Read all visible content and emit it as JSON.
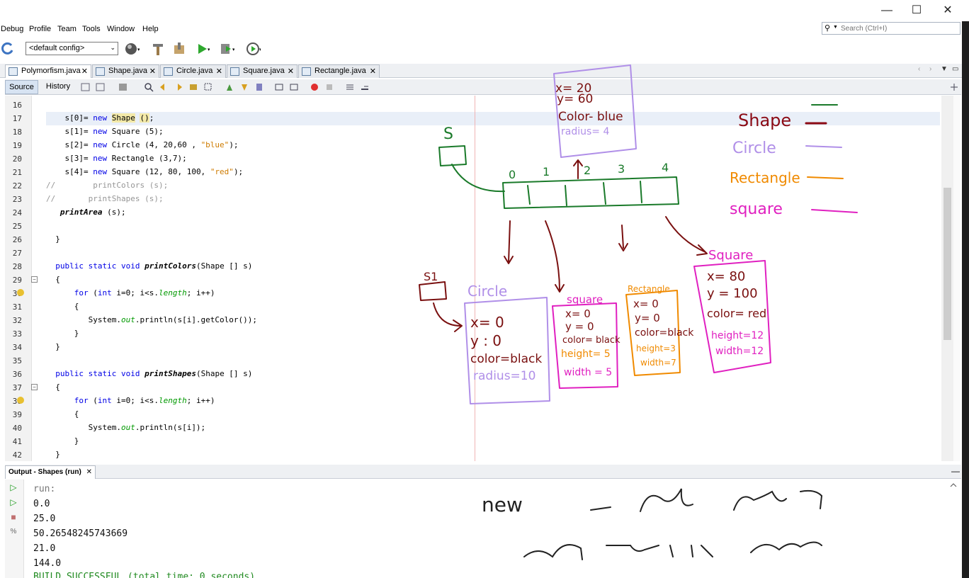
{
  "window": {
    "minimize_glyph": "—",
    "maximize_glyph": "☐",
    "close_glyph": "✕"
  },
  "menu": [
    "Debug",
    "Profile",
    "Team",
    "Tools",
    "Window",
    "Help"
  ],
  "search": {
    "placeholder": "Search (Ctrl+I)"
  },
  "toolbar": {
    "config_value": "<default config>"
  },
  "tabs": [
    {
      "label": "Polymorfism.java",
      "active": true
    },
    {
      "label": "Shape.java",
      "active": false
    },
    {
      "label": "Circle.java",
      "active": false
    },
    {
      "label": "Square.java",
      "active": false
    },
    {
      "label": "Rectangle.java",
      "active": false
    }
  ],
  "editor_toolbar": {
    "source": "Source",
    "history": "History"
  },
  "code": {
    "line_numbers": [
      "16",
      "17",
      "18",
      "19",
      "20",
      "21",
      "22",
      "23",
      "24",
      "25",
      "26",
      "27",
      "28",
      "29",
      "30",
      "31",
      "32",
      "33",
      "34",
      "35",
      "36",
      "37",
      "38",
      "39",
      "40",
      "41",
      "42"
    ]
  },
  "output": {
    "title": "Output - Shapes (run)",
    "lines": [
      "run:",
      "0.0",
      "25.0",
      "50.26548245743669",
      "21.0",
      "144.0",
      "BUILD SUCCESSFUL (total time: 0 seconds)"
    ]
  },
  "annotations": {
    "legend": [
      "Shape",
      "Circle",
      "Rectangle",
      "square"
    ],
    "array_indices": [
      "0",
      "1",
      "2",
      "3",
      "4"
    ],
    "labels": {
      "s": "S",
      "s1": "S1",
      "new": "new"
    },
    "circle_obj": {
      "title": "Circle",
      "x": "x= 0",
      "y": "y : 0",
      "color": "color=black",
      "radius": "radius=10"
    },
    "square_obj": {
      "title": "square",
      "x": "x= 0",
      "y": "y = 0",
      "color": "color= black",
      "height": "height= 5",
      "width": "width = 5"
    },
    "rect_obj": {
      "title": "Rectangle",
      "x": "x= 0",
      "y": "y= 0",
      "color": "color=black",
      "height": "height=3",
      "width": "width=7"
    },
    "square2_obj": {
      "title": "Square",
      "x": "x= 80",
      "y": "y = 100",
      "color": "color= red",
      "height": "height=12",
      "width": "width=12"
    },
    "circle_top": {
      "x": "x= 20",
      "y": "y= 60",
      "color": "Color- blue",
      "radius": "radius= 4"
    },
    "colors": {
      "shape": "#8b0a14",
      "circle": "#b08fe8",
      "rect": "#f08a00",
      "square": "#e020c0",
      "green": "#1a7a2a"
    }
  }
}
